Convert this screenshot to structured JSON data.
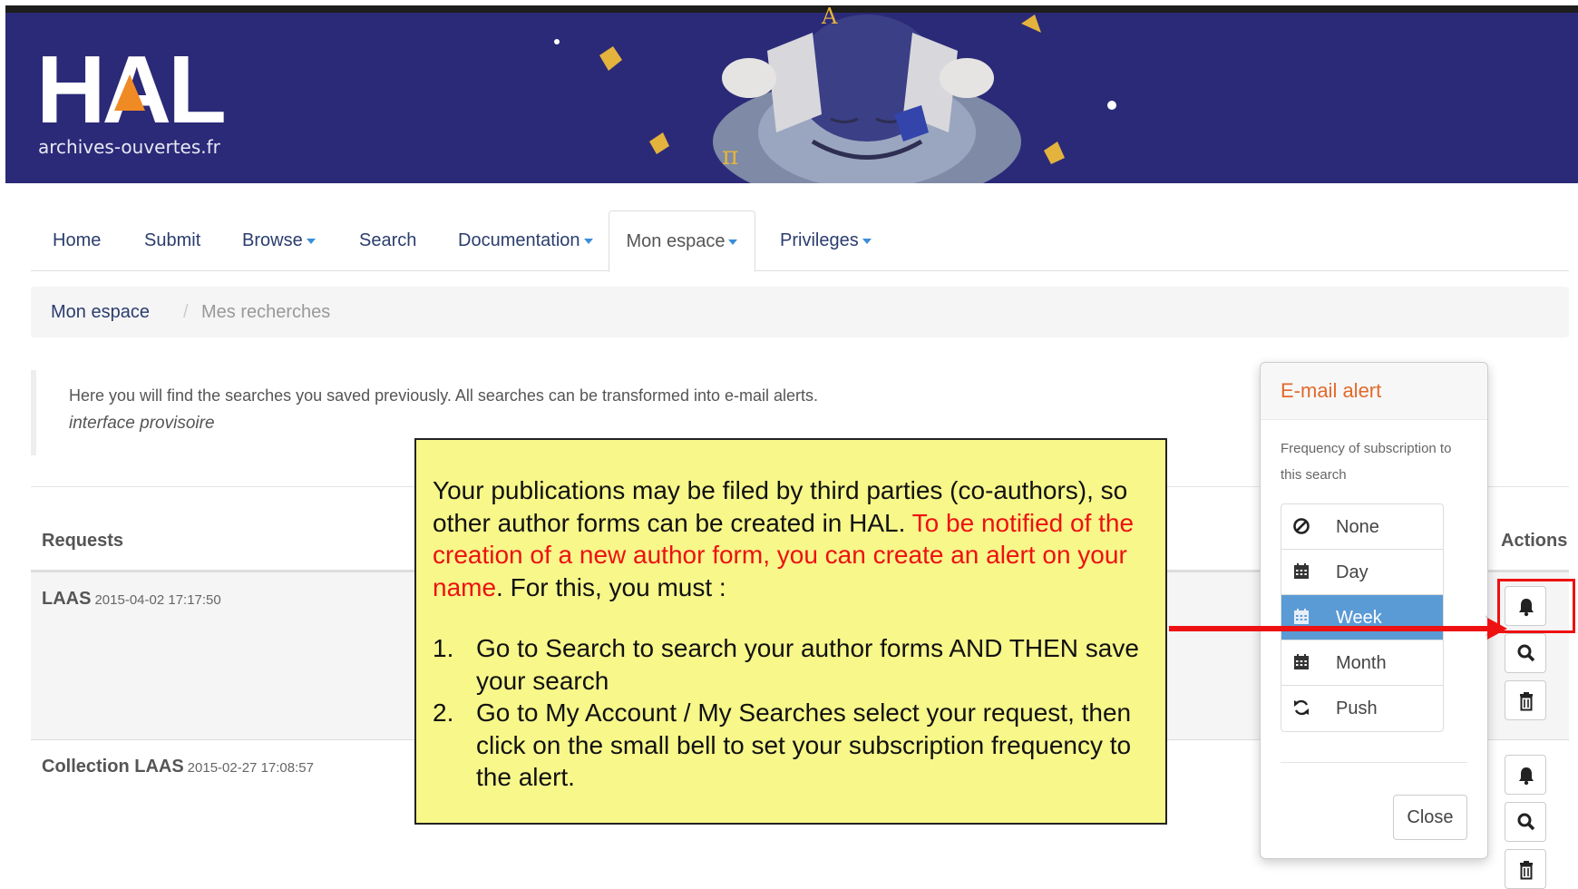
{
  "header": {
    "logo_text": "HAL",
    "logo_subtitle": "archives-ouvertes.fr"
  },
  "nav": {
    "items": [
      {
        "label": "Home",
        "dropdown": false
      },
      {
        "label": "Submit",
        "dropdown": false
      },
      {
        "label": "Browse",
        "dropdown": true
      },
      {
        "label": "Search",
        "dropdown": false
      },
      {
        "label": "Documentation",
        "dropdown": true
      },
      {
        "label": "Mon espace",
        "dropdown": true,
        "active": true
      },
      {
        "label": "Privileges",
        "dropdown": true
      }
    ]
  },
  "breadcrumb": {
    "parent": "Mon espace",
    "separator": "/",
    "current": "Mes recherches"
  },
  "info": {
    "text": "Here you will find the searches you saved previously. All searches can be transformed into e-mail alerts.",
    "subtext": "interface provisoire"
  },
  "table": {
    "headers": {
      "requests": "Requests",
      "actions": "Actions"
    },
    "rows": [
      {
        "name": "LAAS",
        "date": "2015-04-02 17:17:50"
      },
      {
        "name": "Collection LAAS",
        "date": "2015-02-27 17:08:57"
      }
    ]
  },
  "actions": {
    "icons": [
      "bell-icon",
      "search-icon",
      "trash-icon"
    ]
  },
  "email_alert": {
    "title": "E-mail alert",
    "description": "Frequency of subscription to this search",
    "options": [
      {
        "label": "None",
        "icon": "ban-icon"
      },
      {
        "label": "Day",
        "icon": "calendar-icon"
      },
      {
        "label": "Week",
        "icon": "calendar-icon",
        "selected": true
      },
      {
        "label": "Month",
        "icon": "calendar-icon"
      },
      {
        "label": "Push",
        "icon": "refresh-icon"
      }
    ],
    "close_label": "Close"
  },
  "note": {
    "intro": "Your publications may be filed by third parties (co-authors), so other author forms can be created in HAL.",
    "highlight": "To be notified of the creation of a new author form, you can create an alert on your name",
    "outro": ". For this, you must :",
    "steps": [
      {
        "num": "1.",
        "text": "Go to Search to search your author forms AND THEN save your search"
      },
      {
        "num": "2.",
        "text": "Go to My Account / My Searches select your request, then click on the small bell to set your subscription frequency to the alert."
      }
    ]
  },
  "colors": {
    "banner": "#2b2a78",
    "link": "#2b3d6e",
    "accent_orange": "#e26a2c",
    "selected_blue": "#5b9bd5",
    "note_yellow": "#f7f78a",
    "annotation_red": "#ee1111"
  }
}
